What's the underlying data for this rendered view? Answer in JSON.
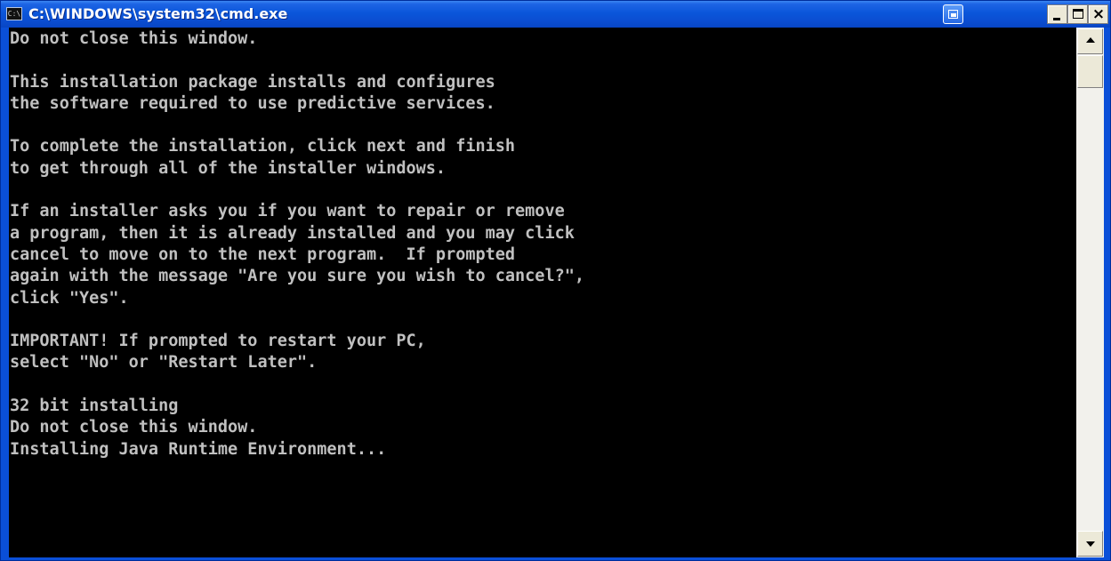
{
  "window": {
    "title": "C:\\WINDOWS\\system32\\cmd.exe",
    "icon": "console-app-icon",
    "icon_glyph": "C:\\"
  },
  "titlebar_buttons": {
    "extra": "window-extra-icon",
    "minimize": "minimize-icon",
    "maximize": "maximize-icon",
    "close": "close-icon",
    "close_glyph": "×"
  },
  "console": {
    "lines": [
      "Do not close this window.",
      "",
      "This installation package installs and configures",
      "the software required to use predictive services.",
      "",
      "To complete the installation, click next and finish",
      "to get through all of the installer windows.",
      "",
      "If an installer asks you if you want to repair or remove",
      "a program, then it is already installed and you may click",
      "cancel to move on to the next program.  If prompted",
      "again with the message \"Are you sure you wish to cancel?\",",
      "click \"Yes\".",
      "",
      "IMPORTANT! If prompted to restart your PC,",
      "select \"No\" or \"Restart Later\".",
      "",
      "32 bit installing",
      "Do not close this window.",
      "Installing Java Runtime Environment..."
    ]
  },
  "scrollbar": {
    "up_icon": "scroll-up-arrow-icon",
    "down_icon": "scroll-down-arrow-icon"
  },
  "colors": {
    "titlebar": "#0a56da",
    "console_background": "#000000",
    "console_text": "#c0c0c0"
  }
}
